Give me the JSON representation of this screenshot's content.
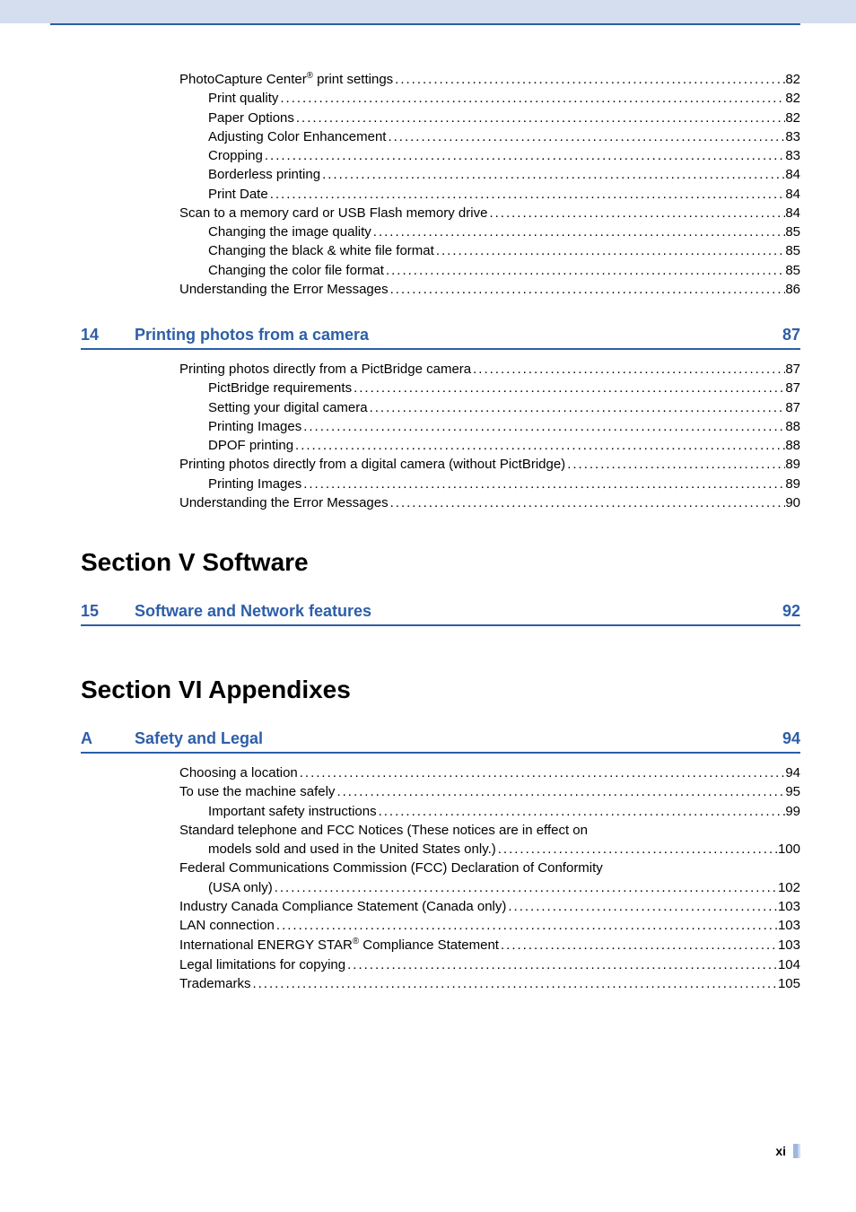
{
  "block1": [
    {
      "indent": 1,
      "label": "PhotoCapture Center",
      "sup": "®",
      "suffix": " print settings ",
      "page": "82"
    },
    {
      "indent": 2,
      "label": "Print quality",
      "page": "82"
    },
    {
      "indent": 2,
      "label": "Paper Options",
      "page": "82"
    },
    {
      "indent": 2,
      "label": "Adjusting Color Enhancement",
      "page": "83"
    },
    {
      "indent": 2,
      "label": "Cropping",
      "page": "83"
    },
    {
      "indent": 2,
      "label": "Borderless printing",
      "page": "84"
    },
    {
      "indent": 2,
      "label": "Print Date",
      "page": "84"
    },
    {
      "indent": 1,
      "label": "Scan to a memory card or USB Flash memory drive ",
      "page": "84"
    },
    {
      "indent": 2,
      "label": "Changing the image quality ",
      "page": "85"
    },
    {
      "indent": 2,
      "label": "Changing the black & white file format ",
      "page": "85"
    },
    {
      "indent": 2,
      "label": "Changing the color file format",
      "page": "85"
    },
    {
      "indent": 1,
      "label": "Understanding the Error Messages",
      "page": "86"
    }
  ],
  "chapter14": {
    "num": "14",
    "title": "Printing photos from a camera",
    "page": "87"
  },
  "block2": [
    {
      "indent": 1,
      "label": "Printing photos directly from a PictBridge camera",
      "page": "87"
    },
    {
      "indent": 2,
      "label": "PictBridge requirements ",
      "page": "87"
    },
    {
      "indent": 2,
      "label": "Setting your digital camera ",
      "page": "87"
    },
    {
      "indent": 2,
      "label": "Printing Images",
      "page": "88"
    },
    {
      "indent": 2,
      "label": "DPOF printing",
      "page": "88"
    },
    {
      "indent": 1,
      "label": "Printing photos directly from a digital camera (without PictBridge)",
      "page": "89"
    },
    {
      "indent": 2,
      "label": "Printing Images",
      "page": "89"
    },
    {
      "indent": 1,
      "label": "Understanding the Error Messages",
      "page": "90"
    }
  ],
  "sectionV": "Section V   Software",
  "chapter15": {
    "num": "15",
    "title": "Software and Network features",
    "page": "92"
  },
  "sectionVI": "Section VI  Appendixes",
  "chapterA": {
    "num": "A",
    "title": "Safety and Legal",
    "page": "94"
  },
  "block3": [
    {
      "indent": 1,
      "label": "Choosing a location ",
      "page": "94"
    },
    {
      "indent": 1,
      "label": "To use the machine safely",
      "page": "95"
    },
    {
      "indent": 2,
      "label": "Important safety instructions",
      "page": "99"
    },
    {
      "indent": 1,
      "wrap": true,
      "line1": "Standard telephone and FCC Notices (These notices are in effect on",
      "line2": "models sold and used in the United States only.) ",
      "page": "100"
    },
    {
      "indent": 1,
      "wrap": true,
      "line1": "Federal Communications Commission (FCC) Declaration of Conformity",
      "line2": "(USA only) ",
      "page": "102"
    },
    {
      "indent": 1,
      "label": "Industry Canada Compliance Statement (Canada only) ",
      "page": "103"
    },
    {
      "indent": 1,
      "label": "LAN connection ",
      "page": "103"
    },
    {
      "indent": 1,
      "label": "International ENERGY STAR",
      "sup": "®",
      "suffix": " Compliance Statement ",
      "page": "103"
    },
    {
      "indent": 1,
      "label": "Legal limitations for copying ",
      "page": "104"
    },
    {
      "indent": 1,
      "label": "Trademarks",
      "page": "105"
    }
  ],
  "pagenum": "xi"
}
